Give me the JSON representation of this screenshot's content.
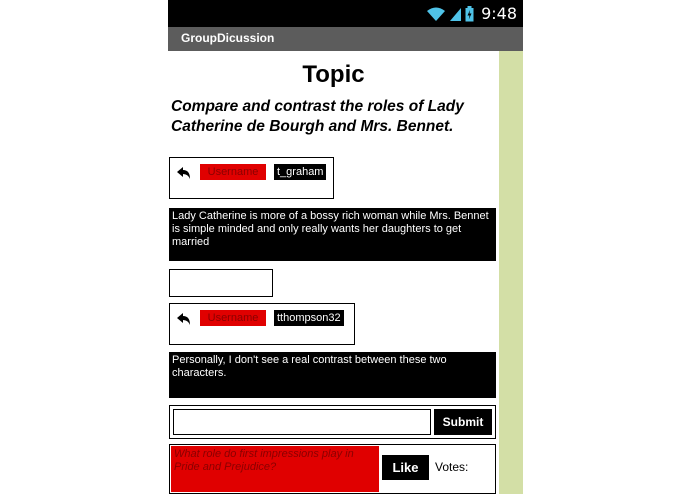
{
  "status_bar": {
    "time": "9:48",
    "icons": [
      "wifi-icon",
      "signal-icon",
      "battery-icon"
    ]
  },
  "app": {
    "title": "GroupDicussion"
  },
  "topic": {
    "title": "Topic",
    "question": "Compare and contrast the roles of Lady Catherine de Bourgh and Mrs. Bennet."
  },
  "posts": [
    {
      "username_label": "Username",
      "username": "t_graham",
      "comment": "Lady Catherine is more of a bossy rich woman while Mrs. Bennet is simple minded and only really wants her daughters to get married"
    },
    {
      "username_label": "Username",
      "username": "tthompson32",
      "comment": "Personally, I don't see a real contrast between these two characters."
    }
  ],
  "reply": {
    "submit_label": "Submit",
    "value": ""
  },
  "next_topic": {
    "question": "What role do first impressions play in Pride and Prejudice?",
    "like_label": "Like",
    "votes_label": "Votes:"
  },
  "colors": {
    "label_red": "#e00000",
    "scroll_green": "#d3dfa6",
    "title_bar": "#5c5c5c"
  }
}
